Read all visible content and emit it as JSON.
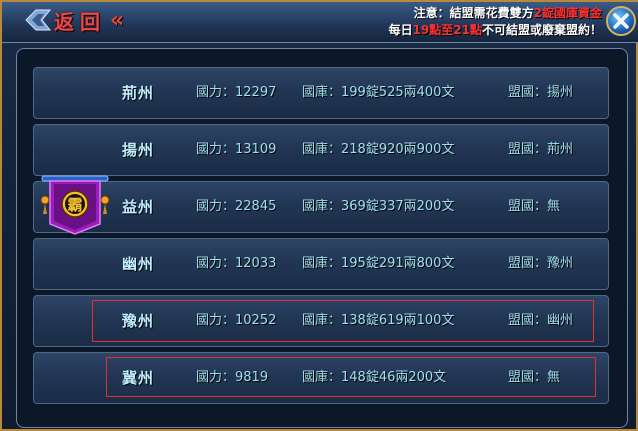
{
  "header": {
    "back_label": "返回",
    "back_arrow": "«",
    "notice": {
      "line1_prefix": "注意：結盟需花費雙方",
      "line1_highlight": "2錠國庫資金",
      "line2_prefix": "每日",
      "line2_highlight": "19點至21點",
      "line2_suffix": "不可結盟或廢棄盟約！"
    },
    "close_icon": "close-x-icon"
  },
  "rows": [
    {
      "state": "荊州",
      "power": "國力：12297",
      "treasury": "國庫：199錠525兩400文",
      "ally": "盟國：揚州"
    },
    {
      "state": "揚州",
      "power": "國力：13109",
      "treasury": "國庫：218錠920兩900文",
      "ally": "盟國：荊州"
    },
    {
      "state": "益州",
      "power": "國力：22845",
      "treasury": "國庫：369錠337兩200文",
      "ally": "盟國：無"
    },
    {
      "state": "幽州",
      "power": "國力：12033",
      "treasury": "國庫：195錠291兩800文",
      "ally": "盟國：豫州"
    },
    {
      "state": "豫州",
      "power": "國力：10252",
      "treasury": "國庫：138錠619兩100文",
      "ally": "盟國：幽州"
    },
    {
      "state": "冀州",
      "power": "國力：9819",
      "treasury": "國庫：148錠46兩200文",
      "ally": "盟國：無"
    }
  ],
  "banner": {
    "glyph": "霸",
    "icon": "hegemon-banner-icon"
  },
  "colors": {
    "accent_red": "#ff3030",
    "gold": "#f0c040",
    "text_cyan": "#9fe1f2"
  }
}
